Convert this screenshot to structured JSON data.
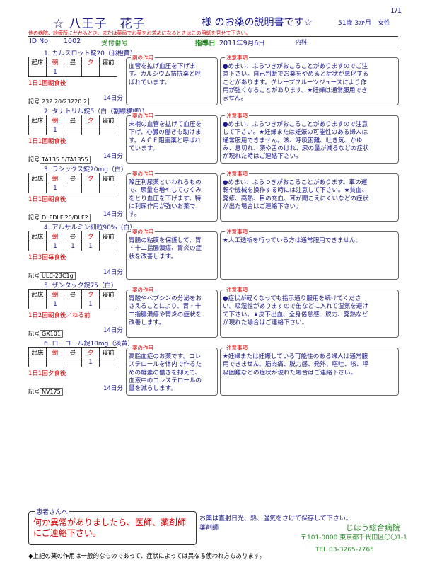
{
  "header": {
    "page": "1/1",
    "patient_name": "☆ 八王子　花子",
    "title_suffix": "様 のお薬の説明書です☆",
    "age_sex": "51歳 3か月　女性",
    "note": "他の病院、診療所にかかるとき、または薬局でお薬をお求めになるときはこの用紙を見せて下さい。",
    "id_label": "ID No",
    "id_value": "1002",
    "reception_label": "受付番号",
    "guidance_label": "指導日",
    "guidance_date": "2011年9月6日",
    "department": "内科"
  },
  "schedule_labels": [
    "起床",
    "朝",
    "昼",
    "夕",
    "寝前"
  ],
  "labels": {
    "effect": "薬の作用",
    "caution": "注意事項",
    "code": "記号"
  },
  "drugs": [
    {
      "title": "1. カルスロット錠20（淡橙黄）",
      "amounts": [
        "",
        "1",
        "",
        "",
        ""
      ],
      "dosage": "1日1回朝食後",
      "code": "232:20/23220:2",
      "days": "14日分",
      "effect": [
        "血管を拡げ血圧を下げま",
        "す。カルシウム拮抗薬と呼",
        "ばれています。"
      ],
      "caution": [
        "●めまい、ふらつきがおこることがありますのでご注",
        "意下さい。自己判断でお薬をやめると症状が悪化する",
        "ことがあります。グレープフルーツジュースにより作",
        "用が強くなることがあります。★妊婦は通常服用でき",
        "ません。"
      ]
    },
    {
      "title": "2. タナトリル錠5（白（割線横様））",
      "amounts": [
        "",
        "1",
        "",
        "",
        ""
      ],
      "dosage": "1日1回朝食後",
      "code": "TA135:5/TA1355",
      "days": "14日分",
      "effect": [
        "末梢の血管を拡げて血圧を",
        "下げ、心臓の働きも助けま",
        "す。ＡＣＥ阻害薬と呼ばれ",
        "ています。"
      ],
      "caution": [
        "●めまい、ふらつきがおこることがありますので注意",
        "して下さい。★妊婦または妊娠の可能性のある婦人は",
        "通常服用できません。咳、呼吸困難、吐き気、かゆ",
        "み、息切れ、顔や舌のはれ、尿の量が減るなどの症状",
        "が現れた時はご連絡下さい。"
      ]
    },
    {
      "title": "3. ラシックス錠20mg（白）",
      "amounts": [
        "",
        "1",
        "",
        "",
        ""
      ],
      "dosage": "1日1回朝食後",
      "code": "DLFDLF:20/DLF2",
      "days": "14日分",
      "effect": [
        "降圧利尿薬といわれるもの",
        "で、尿量を増やしてむくみ",
        "をとり血圧を下げます。特",
        "に利尿作用が強いお薬で",
        "す。"
      ],
      "caution": [
        "●めまい、ふらつきがおこることがあります。車の運",
        "転や機械を操作する時には注意して下さい。★貧血、",
        "発疹、高熱、目の充血、耳が聞こえにくいなどの症状",
        "が出た場合はご連絡下さい。"
      ]
    },
    {
      "title": "4. アルサルミン細粒90%（白）",
      "amounts": [
        "",
        "1",
        "1",
        "1",
        ""
      ],
      "dosage": "1日3回毎食後",
      "code": "ULC-23C1g",
      "days": "14日分",
      "effect": [
        "胃腸の粘膜を保護して、胃",
        "・十二指腸潰瘍、胃炎の症",
        "状を改善します。"
      ],
      "caution": [
        "★人工透析を行っている方は通常服用できません。"
      ]
    },
    {
      "title": "5. ザンタック錠75（白）",
      "amounts": [
        "",
        "1",
        "",
        "1",
        ""
      ],
      "dosage": "1日2回朝食後／ねる前",
      "code": "GX101",
      "days": "14日分",
      "effect": [
        "胃酸やペプシンの分泌をお",
        "さえることにより、胃・十",
        "二指腸潰瘍や胃炎の症状を",
        "改善します。"
      ],
      "caution": [
        "●症状が軽くなっても指示通り服用を続けてくださ",
        "い。吸湿性がありますので缶などに入れて湿気を避け",
        "て下さい。★皮下出血、全身倦怠感、脱力、発熱など",
        "が現れた場合はご連絡下さい。"
      ]
    },
    {
      "title": "6. ローコール錠10mg（淡黄）",
      "amounts": [
        "",
        "",
        "",
        "1",
        ""
      ],
      "dosage": "1日1回夕食後",
      "code": "NV175",
      "days": "14日分",
      "effect": [
        "高脂血症のお薬です。コレ",
        "ステロールを体内で作るた",
        "めの酵素の働きを抑えて、",
        "血液中のコレステロールの",
        "量を減らします。"
      ],
      "caution": [
        "★妊婦または妊娠している可能性のある婦人は通常服",
        "用できません。筋肉痛、脱力感、発熱、嘔吐、咳、呼",
        "吸困難などの症状が現れた場合はご連絡下さい。"
      ]
    }
  ],
  "footer": {
    "patient_label": "患者さんへ",
    "patient_msg1": "何か異常がありましたら、医師、薬剤師",
    "patient_msg2": "にご連絡下さい。",
    "storage": "お薬は直射日光、熱、湿気をさけて保存して下さい。",
    "pharmacist_label": "薬剤師",
    "hospital": "じほう総合病院",
    "address": "〒101-0000 東京都千代田区〇〇1-1",
    "tel": "TEL 03-3265-7765",
    "disclaimer": "◆上記の薬の作用は一般的なものであって、症状によっては異なる使われ方もあります。"
  }
}
